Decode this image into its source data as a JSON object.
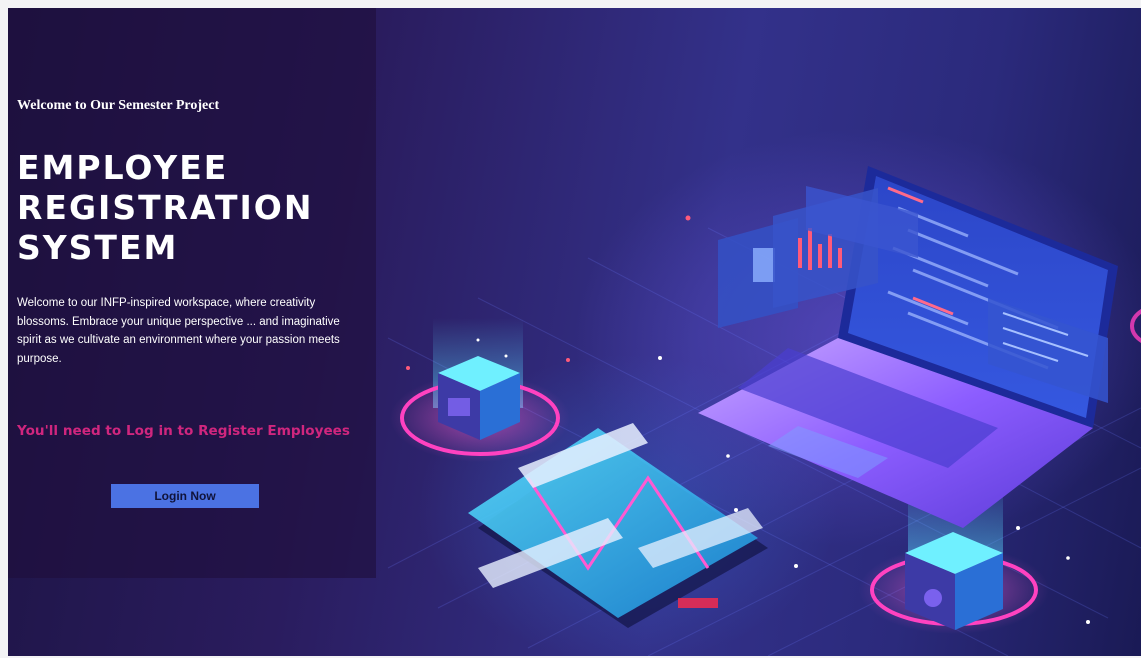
{
  "hero": {
    "welcome_heading": "Welcome to Our Semester Project",
    "title_lines": [
      "EMPLOYEE",
      "REGISTRATION",
      "SYSTEM"
    ],
    "description": "Welcome to our INFP-inspired workspace, where creativity blossoms. Embrace your unique perspective ... and imaginative spirit as we cultivate an environment where your passion meets purpose.",
    "login_notice": "You'll need to Log in to Register Employees",
    "login_button_label": "Login Now"
  },
  "colors": {
    "accent_pink": "#d0267e",
    "button_blue": "#4b72e3",
    "panel_dark": "#1e0e3c"
  },
  "illustration": {
    "subject": "isometric laptop with floating code windows, phone, and glowing server cubes"
  }
}
